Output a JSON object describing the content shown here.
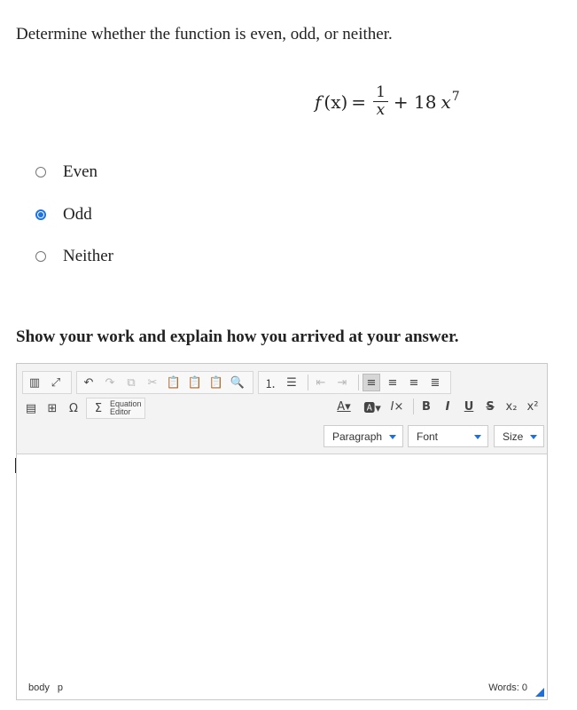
{
  "question": "Determine whether the function is even, odd, or neither.",
  "formula": {
    "lhs_fn": "f",
    "lhs_arg": "(x)",
    "equals": "=",
    "num": "1",
    "den": "x",
    "plus_term": "+ 18",
    "var": "x",
    "exponent": "7"
  },
  "options": [
    {
      "label": "Even",
      "selected": false
    },
    {
      "label": "Odd",
      "selected": true
    },
    {
      "label": "Neither",
      "selected": false
    }
  ],
  "prompt": "Show your work and explain how you arrived at your answer.",
  "editor": {
    "equation_editor_line1": "Equation",
    "equation_editor_line2": "Editor",
    "format_label": "Paragraph",
    "font_label": "Font",
    "size_label": "Size",
    "status_path": "body p",
    "word_count": "Words: 0",
    "accent_color": "#1e6fd9"
  }
}
